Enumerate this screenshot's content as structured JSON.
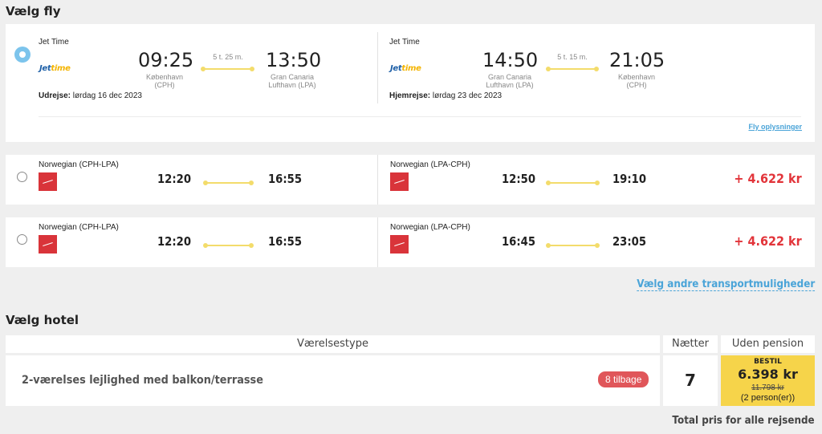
{
  "flights_section": {
    "title": "Vælg fly"
  },
  "selected_flight": {
    "outbound": {
      "airline": "Jet Time",
      "logo": {
        "part1": "Jet",
        "part2": "time"
      },
      "depart_time": "09:25",
      "depart_city": "København",
      "depart_code": "(CPH)",
      "duration": "5 t. 25 m.",
      "arrive_time": "13:50",
      "arrive_city": "Gran Canaria",
      "arrive_code": "Lufthavn (LPA)",
      "date_label": "Udrejse:",
      "date_value": "lørdag 16 dec 2023"
    },
    "return": {
      "airline": "Jet Time",
      "logo": {
        "part1": "Jet",
        "part2": "time"
      },
      "depart_time": "14:50",
      "depart_city": "Gran Canaria",
      "depart_code": "Lufthavn (LPA)",
      "duration": "5 t. 15 m.",
      "arrive_time": "21:05",
      "arrive_city": "København",
      "arrive_code": "(CPH)",
      "date_label": "Hjemrejse:",
      "date_value": "lørdag 23 dec 2023"
    },
    "info_link": "Fly oplysninger"
  },
  "alt_flights": [
    {
      "outbound": {
        "airline": "Norwegian (CPH-LPA)",
        "depart": "12:20",
        "arrive": "16:55"
      },
      "return": {
        "airline": "Norwegian (LPA-CPH)",
        "depart": "12:50",
        "arrive": "19:10"
      },
      "price": "+ 4.622 kr"
    },
    {
      "outbound": {
        "airline": "Norwegian (CPH-LPA)",
        "depart": "12:20",
        "arrive": "16:55"
      },
      "return": {
        "airline": "Norwegian (LPA-CPH)",
        "depart": "16:45",
        "arrive": "23:05"
      },
      "price": "+ 4.622 kr"
    }
  ],
  "transport_link": "Vælg andre transportmuligheder",
  "hotel_section": {
    "title": "Vælg hotel",
    "headers": {
      "room_type": "Værelsestype",
      "nights": "Nætter",
      "board": "Uden pension"
    },
    "row": {
      "room_name": "2-værelses lejlighed med balkon/terrasse",
      "left_badge": "8 tilbage",
      "nights": "7",
      "order_label": "BESTIL",
      "price": "6.398 kr",
      "old_price": "11.798 kr",
      "persons": "(2 person(er))"
    },
    "total_label": "Total pris for alle rejsende"
  },
  "colors": {
    "accent_blue": "#4aa4d8",
    "price_red": "#e2343a",
    "order_yellow": "#f6d44a",
    "badge_red": "#e0565a",
    "flight_track": "#f3dc6b",
    "norwegian_red": "#d9343a"
  }
}
